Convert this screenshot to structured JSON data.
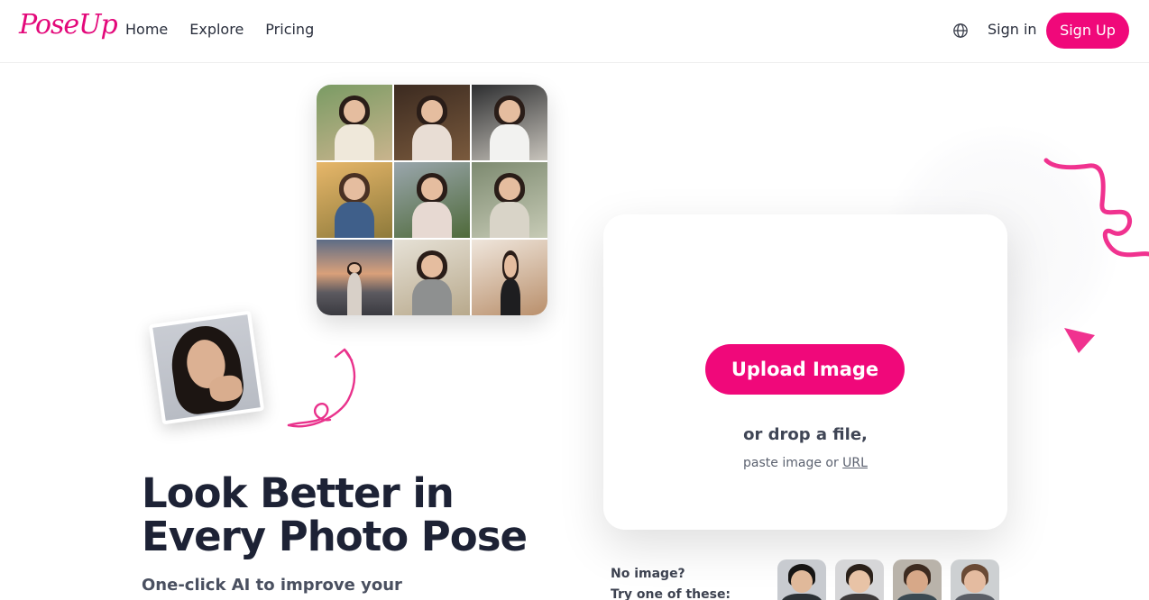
{
  "header": {
    "logo": "PoseUp",
    "nav": [
      "Home",
      "Explore",
      "Pricing"
    ],
    "sign_in": "Sign in",
    "sign_up": "Sign Up"
  },
  "hero": {
    "headline_line1": "Look Better in",
    "headline_line2": "Every Photo Pose",
    "subline": "One-click AI to improve your"
  },
  "upload": {
    "button": "Upload Image",
    "drop_text": "or drop a file,",
    "paste_prefix": "paste image or ",
    "paste_link": "URL"
  },
  "samples": {
    "line1": "No image?",
    "line2": "Try one of these:"
  },
  "colors": {
    "accent": "#f0087a",
    "headline": "#1d2235"
  }
}
